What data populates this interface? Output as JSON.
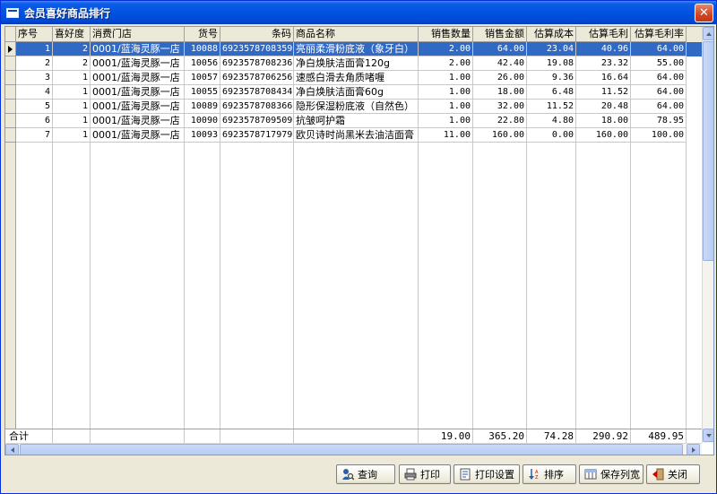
{
  "window": {
    "title": "会员喜好商品排行",
    "close_glyph": "✕"
  },
  "columns": [
    "序号",
    "喜好度",
    "消费门店",
    "货号",
    "条码",
    "商品名称",
    "销售数量",
    "销售金额",
    "估算成本",
    "估算毛利",
    "估算毛利率"
  ],
  "rows": [
    [
      "1",
      "2",
      "0001/蓝海灵豚一店",
      "10088",
      "6923578708359",
      "亮丽柔滑粉底液（象牙白）",
      "2.00",
      "64.00",
      "23.04",
      "40.96",
      "64.00"
    ],
    [
      "2",
      "2",
      "0001/蓝海灵豚一店",
      "10056",
      "6923578708236",
      "净白焕肤洁面膏120g",
      "2.00",
      "42.40",
      "19.08",
      "23.32",
      "55.00"
    ],
    [
      "3",
      "1",
      "0001/蓝海灵豚一店",
      "10057",
      "6923578706256",
      "速感白滑去角质啫喱",
      "1.00",
      "26.00",
      "9.36",
      "16.64",
      "64.00"
    ],
    [
      "4",
      "1",
      "0001/蓝海灵豚一店",
      "10055",
      "6923578708434",
      "净白焕肤洁面膏60g",
      "1.00",
      "18.00",
      "6.48",
      "11.52",
      "64.00"
    ],
    [
      "5",
      "1",
      "0001/蓝海灵豚一店",
      "10089",
      "6923578708366",
      "隐形保湿粉底液（自然色）",
      "1.00",
      "32.00",
      "11.52",
      "20.48",
      "64.00"
    ],
    [
      "6",
      "1",
      "0001/蓝海灵豚一店",
      "10090",
      "6923578709509",
      "抗皱呵护霜",
      "1.00",
      "22.80",
      "4.80",
      "18.00",
      "78.95"
    ],
    [
      "7",
      "1",
      "0001/蓝海灵豚一店",
      "10093",
      "6923578717979",
      "欧贝诗时尚黑米去油洁面膏",
      "11.00",
      "160.00",
      "0.00",
      "160.00",
      "100.00"
    ]
  ],
  "selected_row": 0,
  "footer": {
    "label": "合计",
    "qty": "19.00",
    "amount": "365.20",
    "cost": "74.28",
    "profit": "290.92",
    "rate": "489.95"
  },
  "buttons": [
    {
      "label": "查询",
      "icon": "search-people-icon"
    },
    {
      "label": "打印",
      "icon": "printer-icon"
    },
    {
      "label": "打印设置",
      "icon": "print-settings-icon"
    },
    {
      "label": "排序",
      "icon": "sort-icon"
    },
    {
      "label": "保存列宽",
      "icon": "save-column-width-icon"
    },
    {
      "label": "关闭",
      "icon": "close-door-icon"
    }
  ]
}
